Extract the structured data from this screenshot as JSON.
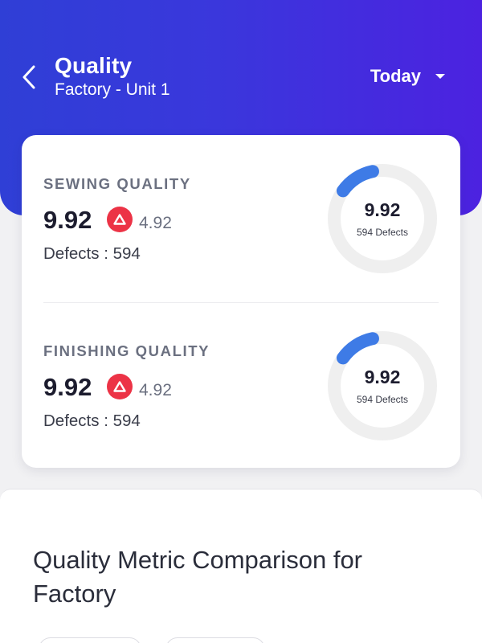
{
  "header": {
    "title": "Quality",
    "subtitle": "Factory - Unit 1",
    "period": "Today",
    "back_icon": "chevron-left-icon",
    "caret_icon": "caret-down-icon",
    "gradient": [
      "#2f3fd6",
      "#4c22e0"
    ]
  },
  "metrics": [
    {
      "label": "SEWING QUALITY",
      "value": "9.92",
      "trend_icon": "triangle-up-icon",
      "delta": "4.92",
      "defects_text": "Defects : 594",
      "donut_value": "9.92",
      "donut_sub": "594 Defects",
      "progress_fraction": 0.12
    },
    {
      "label": "FINISHING QUALITY",
      "value": "9.92",
      "trend_icon": "triangle-up-icon",
      "delta": "4.92",
      "defects_text": "Defects : 594",
      "donut_value": "9.92",
      "donut_sub": "594 Defects",
      "progress_fraction": 0.12
    }
  ],
  "comparison": {
    "title": "Quality Metric Comparison for Factory"
  },
  "colors": {
    "accent": "#3e7be6",
    "badge": "#ec3346",
    "track": "#efefef"
  }
}
